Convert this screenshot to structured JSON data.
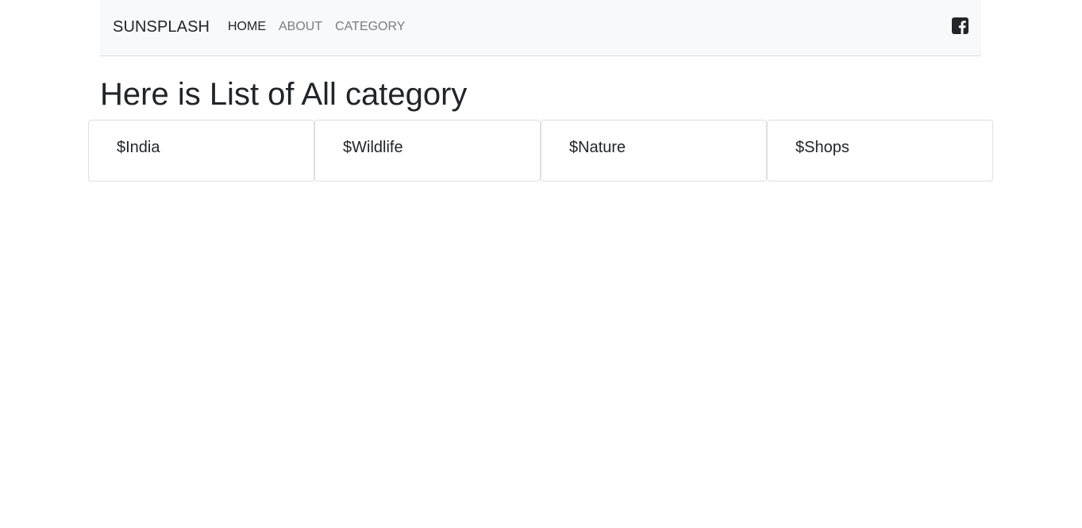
{
  "navbar": {
    "brand": "SUNSPLASH",
    "links": [
      {
        "label": "HOME",
        "active": true
      },
      {
        "label": "ABOUT",
        "active": false
      },
      {
        "label": "CATEGORY",
        "active": false
      }
    ],
    "social_icon": "facebook-square-icon"
  },
  "main": {
    "title": "Here is List of All category",
    "categories": [
      {
        "label": "$India"
      },
      {
        "label": "$Wildlife"
      },
      {
        "label": "$Nature"
      },
      {
        "label": "$Shops"
      }
    ]
  },
  "colors": {
    "navbar_bg": "#f8f9fa",
    "text": "#212529",
    "nav_inactive": "#7a7d80"
  }
}
